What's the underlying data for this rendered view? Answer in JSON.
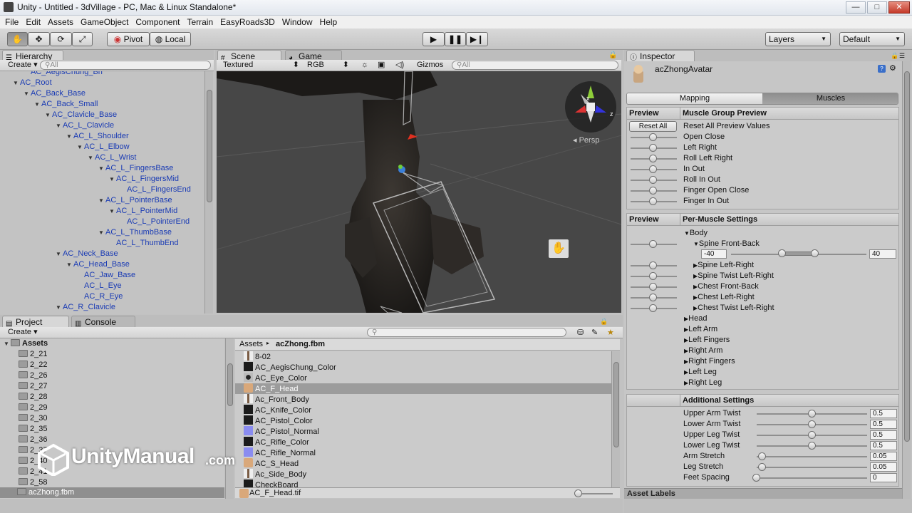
{
  "window": {
    "title": "Unity - Untitled - 3dVillage - PC, Mac & Linux Standalone*",
    "controls": [
      "—",
      "□",
      "✕"
    ]
  },
  "menu": [
    "File",
    "Edit",
    "Assets",
    "GameObject",
    "Component",
    "Terrain",
    "EasyRoads3D",
    "Window",
    "Help"
  ],
  "toolbar": {
    "pivot": "Pivot",
    "local": "Local",
    "layers": "Layers",
    "layout": "Default"
  },
  "hierarchy": {
    "tab": "Hierarchy",
    "create": "Create",
    "search_placeholder": "All",
    "items": [
      {
        "label": "AC_AegisChung_Bn",
        "depth": 1,
        "arrow": ""
      },
      {
        "label": "AC_Root",
        "depth": 0,
        "arrow": "▼"
      },
      {
        "label": "AC_Back_Base",
        "depth": 1,
        "arrow": "▼"
      },
      {
        "label": "AC_Back_Small",
        "depth": 2,
        "arrow": "▼"
      },
      {
        "label": "AC_Clavicle_Base",
        "depth": 3,
        "arrow": "▼"
      },
      {
        "label": "AC_L_Clavicle",
        "depth": 4,
        "arrow": "▼"
      },
      {
        "label": "AC_L_Shoulder",
        "depth": 5,
        "arrow": "▼"
      },
      {
        "label": "AC_L_Elbow",
        "depth": 6,
        "arrow": "▼"
      },
      {
        "label": "AC_L_Wrist",
        "depth": 7,
        "arrow": "▼"
      },
      {
        "label": "AC_L_FingersBase",
        "depth": 8,
        "arrow": "▼"
      },
      {
        "label": "AC_L_FingersMid",
        "depth": 9,
        "arrow": "▼"
      },
      {
        "label": "AC_L_FingersEnd",
        "depth": 10,
        "arrow": ""
      },
      {
        "label": "AC_L_PointerBase",
        "depth": 8,
        "arrow": "▼"
      },
      {
        "label": "AC_L_PointerMid",
        "depth": 9,
        "arrow": "▼"
      },
      {
        "label": "AC_L_PointerEnd",
        "depth": 10,
        "arrow": ""
      },
      {
        "label": "AC_L_ThumbBase",
        "depth": 8,
        "arrow": "▼"
      },
      {
        "label": "AC_L_ThumbEnd",
        "depth": 9,
        "arrow": ""
      },
      {
        "label": "AC_Neck_Base",
        "depth": 4,
        "arrow": "▼"
      },
      {
        "label": "AC_Head_Base",
        "depth": 5,
        "arrow": "▼"
      },
      {
        "label": "AC_Jaw_Base",
        "depth": 6,
        "arrow": ""
      },
      {
        "label": "AC_L_Eye",
        "depth": 6,
        "arrow": ""
      },
      {
        "label": "AC_R_Eye",
        "depth": 6,
        "arrow": ""
      },
      {
        "label": "AC_R_Clavicle",
        "depth": 4,
        "arrow": "▼"
      }
    ]
  },
  "scene": {
    "tab_scene": "Scene",
    "tab_game": "Game",
    "render_mode": "Textured",
    "color_mode": "RGB",
    "gizmos": "Gizmos",
    "search_placeholder": "All",
    "persp": "Persp",
    "gizmo_x": "x",
    "gizmo_z": "z"
  },
  "project": {
    "tab": "Project",
    "console_tab": "Console",
    "create": "Create",
    "root": "Assets",
    "folders": [
      "2_21",
      "2_22",
      "2_26",
      "2_27",
      "2_28",
      "2_29",
      "2_30",
      "2_35",
      "2_36",
      "2_37",
      "2_40",
      "2_41",
      "2_58",
      "acZhong.fbm"
    ],
    "breadcrumb": [
      "Assets",
      "acZhong.fbm"
    ],
    "assets": [
      {
        "name": "8-02",
        "icon": "figure"
      },
      {
        "name": "AC_AegisChung_Color",
        "icon": "dark"
      },
      {
        "name": "AC_Eye_Color",
        "icon": "eye"
      },
      {
        "name": "AC_F_Head",
        "icon": "face"
      },
      {
        "name": "Ac_Front_Body",
        "icon": "figure"
      },
      {
        "name": "AC_Knife_Color",
        "icon": "dark"
      },
      {
        "name": "AC_Pistol_Color",
        "icon": "dark"
      },
      {
        "name": "AC_Pistol_Normal",
        "icon": "normal"
      },
      {
        "name": "AC_Rifle_Color",
        "icon": "dark"
      },
      {
        "name": "AC_Rifle_Normal",
        "icon": "normal"
      },
      {
        "name": "AC_S_Head",
        "icon": "face"
      },
      {
        "name": "Ac_Side_Body",
        "icon": "figure"
      },
      {
        "name": "CheckBoard",
        "icon": "dark"
      }
    ],
    "selected_file": "AC_F_Head.tif"
  },
  "watermark": {
    "brand": "UnityManual",
    "suffix": ".com"
  },
  "inspector": {
    "tab": "Inspector",
    "object_name": "acZhongAvatar",
    "tabs": [
      "Mapping",
      "Muscles"
    ],
    "preview_label": "Preview",
    "muscle_group_title": "Muscle Group Preview",
    "reset_all": "Reset All",
    "group_rows": [
      "Reset All Preview Values",
      "Open Close",
      "Left Right",
      "Roll Left Right",
      "In Out",
      "Roll In Out",
      "Finger Open Close",
      "Finger In Out"
    ],
    "per_muscle_title": "Per-Muscle Settings",
    "body_label": "Body",
    "spine_front_back": "Spine Front-Back",
    "range_min": "-40",
    "range_max": "40",
    "body_children": [
      "Spine Left-Right",
      "Spine Twist Left-Right",
      "Chest Front-Back",
      "Chest Left-Right",
      "Chest Twist Left-Right"
    ],
    "groups": [
      "Head",
      "Left Arm",
      "Left Fingers",
      "Right Arm",
      "Right Fingers",
      "Left Leg",
      "Right Leg"
    ],
    "additional_title": "Additional Settings",
    "additional": [
      {
        "label": "Upper Arm Twist",
        "value": "0.5",
        "level": 0.5
      },
      {
        "label": "Lower Arm Twist",
        "value": "0.5",
        "level": 0.5
      },
      {
        "label": "Upper Leg Twist",
        "value": "0.5",
        "level": 0.5
      },
      {
        "label": "Lower Leg Twist",
        "value": "0.5",
        "level": 0.5
      },
      {
        "label": "Arm Stretch",
        "value": "0.05",
        "level": 0.05
      },
      {
        "label": "Leg Stretch",
        "value": "0.05",
        "level": 0.05
      },
      {
        "label": "Feet Spacing",
        "value": "0",
        "level": 0
      }
    ],
    "asset_labels": "Asset Labels"
  }
}
